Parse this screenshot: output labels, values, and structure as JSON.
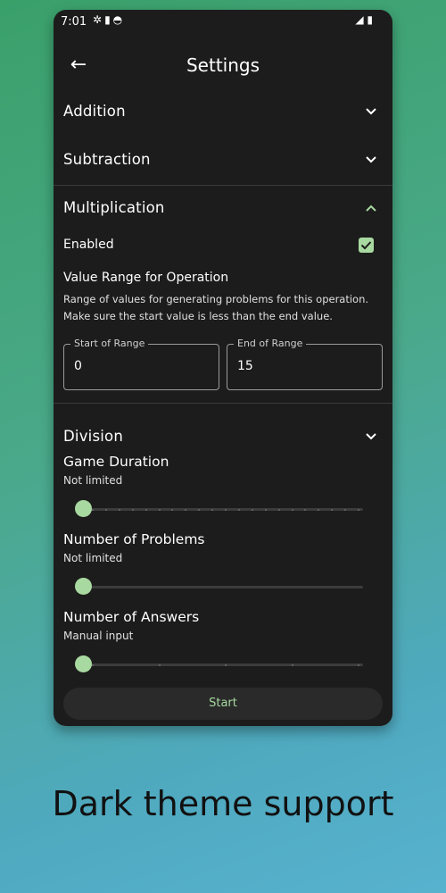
{
  "status_bar": {
    "time": "7:01",
    "left_icons": [
      "settings-icon",
      "sd-card-icon",
      "face-icon"
    ],
    "right_icons": [
      "signal-icon",
      "battery-icon"
    ]
  },
  "app_bar": {
    "title": "Settings"
  },
  "sections": {
    "addition": {
      "label": "Addition"
    },
    "subtraction": {
      "label": "Subtraction"
    },
    "multiplication": {
      "label": "Multiplication",
      "enabled_label": "Enabled",
      "enabled": true,
      "range_title": "Value Range for Operation",
      "range_desc_line1": "Range of values for generating problems for this operation.",
      "range_desc_line2": "Make sure the start value is less than the end value.",
      "start_label": "Start of Range",
      "start_value": "0",
      "end_label": "End of Range",
      "end_value": "15"
    },
    "division": {
      "label": "Division"
    }
  },
  "game_duration": {
    "label": "Game Duration",
    "value": "Not limited",
    "level": 0
  },
  "number_of_problems": {
    "label": "Number of Problems",
    "value": "Not limited",
    "level": 0
  },
  "number_of_answers": {
    "label": "Number of Answers",
    "value": "Manual input",
    "level": 0
  },
  "start_button": {
    "label": "Start"
  },
  "caption": "Dark theme support",
  "colors": {
    "accent": "#a8d9a0",
    "surface": "#1c1c1c",
    "background_from": "#3aa06a",
    "background_to": "#57b2cf"
  }
}
